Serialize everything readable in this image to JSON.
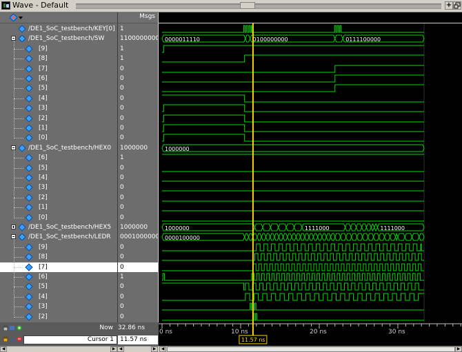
{
  "window": {
    "title": "Wave - Default",
    "close_label": "×",
    "max_label": "+"
  },
  "header": {
    "msgs_label": "Msgs"
  },
  "colors": {
    "wave_green": "#00dd00",
    "cursor_yellow": "#ffd700",
    "panel_gray": "#6d6d6d",
    "selected_row": "#ffffff",
    "diamond_blue": "#3aa0ff"
  },
  "signals": [
    {
      "name": "/DE1_SoC_testbench/KEY[0]",
      "value": "1",
      "level": 0,
      "expander": "",
      "selected": false
    },
    {
      "name": "/DE1_SoC_testbench/SW",
      "value": "1100000000",
      "level": 0,
      "expander": "minus",
      "selected": false
    },
    {
      "name": "[9]",
      "value": "1",
      "level": 1,
      "expander": "",
      "selected": false
    },
    {
      "name": "[8]",
      "value": "1",
      "level": 1,
      "expander": "",
      "selected": false
    },
    {
      "name": "[7]",
      "value": "0",
      "level": 1,
      "expander": "",
      "selected": false
    },
    {
      "name": "[6]",
      "value": "0",
      "level": 1,
      "expander": "",
      "selected": false
    },
    {
      "name": "[5]",
      "value": "0",
      "level": 1,
      "expander": "",
      "selected": false
    },
    {
      "name": "[4]",
      "value": "0",
      "level": 1,
      "expander": "",
      "selected": false
    },
    {
      "name": "[3]",
      "value": "0",
      "level": 1,
      "expander": "",
      "selected": false
    },
    {
      "name": "[2]",
      "value": "0",
      "level": 1,
      "expander": "",
      "selected": false
    },
    {
      "name": "[1]",
      "value": "0",
      "level": 1,
      "expander": "",
      "selected": false
    },
    {
      "name": "[0]",
      "value": "0",
      "level": 1,
      "expander": "",
      "selected": false
    },
    {
      "name": "/DE1_SoC_testbench/HEX0",
      "value": "1000000",
      "level": 0,
      "expander": "minus",
      "selected": false
    },
    {
      "name": "[6]",
      "value": "1",
      "level": 1,
      "expander": "",
      "selected": false
    },
    {
      "name": "[5]",
      "value": "0",
      "level": 1,
      "expander": "",
      "selected": false
    },
    {
      "name": "[4]",
      "value": "0",
      "level": 1,
      "expander": "",
      "selected": false
    },
    {
      "name": "[3]",
      "value": "0",
      "level": 1,
      "expander": "",
      "selected": false
    },
    {
      "name": "[2]",
      "value": "0",
      "level": 1,
      "expander": "",
      "selected": false
    },
    {
      "name": "[1]",
      "value": "0",
      "level": 1,
      "expander": "",
      "selected": false
    },
    {
      "name": "[0]",
      "value": "0",
      "level": 1,
      "expander": "",
      "selected": false
    },
    {
      "name": "/DE1_SoC_testbench/HEX5",
      "value": "1000000",
      "level": 0,
      "expander": "plus",
      "selected": false
    },
    {
      "name": "/DE1_SoC_testbench/LEDR",
      "value": "0001000000",
      "level": 0,
      "expander": "minus",
      "selected": false
    },
    {
      "name": "[9]",
      "value": "0",
      "level": 1,
      "expander": "",
      "selected": false
    },
    {
      "name": "[8]",
      "value": "0",
      "level": 1,
      "expander": "",
      "selected": false
    },
    {
      "name": "[7]",
      "value": "0",
      "level": 1,
      "expander": "",
      "selected": true
    },
    {
      "name": "[6]",
      "value": "1",
      "level": 1,
      "expander": "",
      "selected": false
    },
    {
      "name": "[5]",
      "value": "0",
      "level": 1,
      "expander": "",
      "selected": false
    },
    {
      "name": "[4]",
      "value": "0",
      "level": 1,
      "expander": "",
      "selected": false
    },
    {
      "name": "[3]",
      "value": "0",
      "level": 1,
      "expander": "",
      "selected": false
    },
    {
      "name": "[2]",
      "value": "0",
      "level": 1,
      "expander": "",
      "selected": false
    }
  ],
  "bus_labels": {
    "sw": [
      "0000011110",
      "0100000000",
      "0111100000"
    ],
    "hex0": [
      "1000000"
    ],
    "hex5": [
      "1000000",
      "1111000",
      "1111000"
    ],
    "ledr": [
      "0000100000"
    ]
  },
  "status": {
    "now_label": "Now",
    "now_value": "32.86 ns",
    "cursor_label": "Cursor 1",
    "cursor_value": "11.57 ns",
    "cursor_tag": "11.57 ns"
  },
  "timeline": {
    "ticks": [
      "0 ns",
      "10 ns",
      "20 ns",
      "30 ns"
    ]
  }
}
